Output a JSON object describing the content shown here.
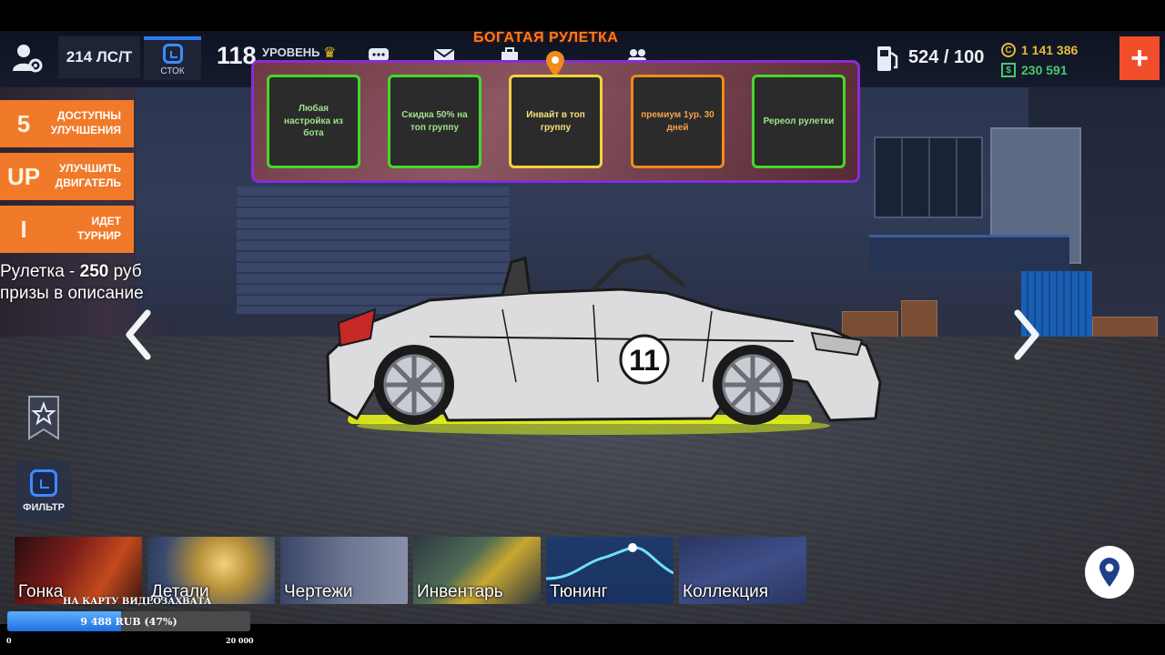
{
  "topbar": {
    "horsepower": "214 ЛС/Т",
    "stock_label": "СТОК",
    "level_number": "118",
    "level_label": "УРОВЕНЬ",
    "fuel": "524 / 100",
    "coins": "1 141 386",
    "dollars": "230 591",
    "plus": "+"
  },
  "roulette": {
    "title": "БОГАТАЯ РУЛЕТКА",
    "prizes": [
      {
        "label": "Любая настройка из бота",
        "color": "#45d72c"
      },
      {
        "label": "Скидка 50% на топ группу",
        "color": "#45d72c"
      },
      {
        "label": "Инвайт в топ группу",
        "color": "#f2d23a"
      },
      {
        "label": "премиум 1ур. 30 дней",
        "color": "#f08a1a"
      },
      {
        "label": "Ререол рулетки",
        "color": "#45d72c"
      }
    ]
  },
  "side_buttons": [
    {
      "big": "5",
      "label_1": "ДОСТУПНЫ",
      "label_2": "УЛУЧШЕНИЯ"
    },
    {
      "big": "UP",
      "label_1": "УЛУЧШИТЬ",
      "label_2": "ДВИГАТЕЛЬ"
    },
    {
      "big": "I",
      "label_1": "ИДЕТ",
      "label_2": "ТУРНИР"
    }
  ],
  "overlay": {
    "line1_prefix": "Рулетка - ",
    "line1_price": "250",
    "line1_suffix": " руб",
    "line2": "призы в описание"
  },
  "filter_label": "ФИЛЬТР",
  "car_number": "11",
  "menu": [
    {
      "label": "Гонка"
    },
    {
      "label": "Детали"
    },
    {
      "label": "Чертежи"
    },
    {
      "label": "Инвентарь"
    },
    {
      "label": "Тюнинг"
    },
    {
      "label": "Коллекция"
    }
  ],
  "donation": {
    "title": "НА КАРТУ ВИДЕОЗАХВАТА",
    "amount_text": "9 488 RUB (47%)",
    "progress_percent": 47,
    "min": "0",
    "max": "20 000"
  },
  "colors": {
    "accent_orange": "#f07a2a",
    "roulette_border": "#8a2bd8",
    "neon_underglow": "#e4f21a",
    "blue_accent": "#3d8bff"
  }
}
